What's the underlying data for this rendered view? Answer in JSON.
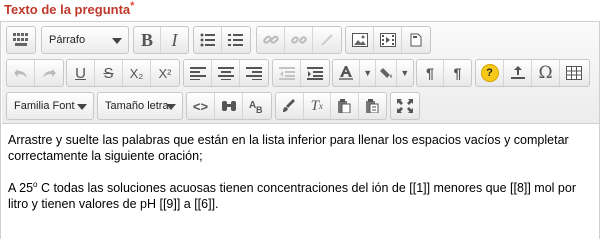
{
  "field": {
    "label": "Texto de la pregunta",
    "required_mark": "*"
  },
  "toolbar": {
    "format_dropdown": "Párrafo",
    "font_dropdown": "Familia Font",
    "size_dropdown": "Tamaño letra",
    "bold": "B",
    "italic": "I",
    "underline": "U",
    "strike": "S",
    "subscript": "X₂",
    "superscript": "X²",
    "pilcrow": "¶",
    "omega": "Ω",
    "bold_icon_label": "B",
    "italic_icon_label": "I"
  },
  "content": {
    "paragraph1": "Arrastre y suelte las palabras que están en la lista inferior para llenar los espacios vacíos y completar correctamente la siguiente oración;",
    "p2_before": "A 25",
    "p2_sup": "o",
    "p2_after": " C todas las soluciones acuosas tienen concentraciones del ión de [[1]] menores que [[8]] mol por litro y tienen valores de pH [[9]] a [[6]]."
  },
  "colors": {
    "label": "#c0392b",
    "required": "#e74c3c",
    "help": "#f7c818"
  }
}
